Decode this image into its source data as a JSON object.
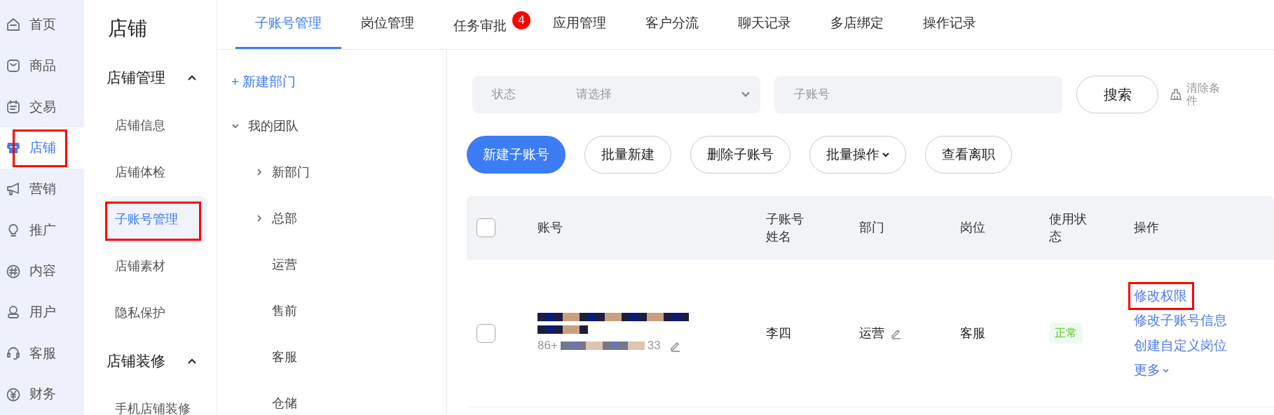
{
  "nav": [
    {
      "label": "首页",
      "selected": false,
      "annotated": false
    },
    {
      "label": "商品",
      "selected": false,
      "annotated": false
    },
    {
      "label": "交易",
      "selected": false,
      "annotated": false
    },
    {
      "label": "店铺",
      "selected": true,
      "annotated": true
    },
    {
      "label": "营销",
      "selected": false,
      "annotated": false
    },
    {
      "label": "推广",
      "selected": false,
      "annotated": false
    },
    {
      "label": "内容",
      "selected": false,
      "annotated": false
    },
    {
      "label": "用户",
      "selected": false,
      "annotated": false
    },
    {
      "label": "客服",
      "selected": false,
      "annotated": false
    },
    {
      "label": "财务",
      "selected": false,
      "annotated": false
    }
  ],
  "sidebar": {
    "title": "店铺",
    "groups": [
      {
        "label": "店铺管理",
        "expanded": true,
        "items": [
          {
            "label": "店铺信息",
            "selected": false,
            "annotated": false
          },
          {
            "label": "店铺体检",
            "selected": false,
            "annotated": false
          },
          {
            "label": "子账号管理",
            "selected": true,
            "annotated": true
          },
          {
            "label": "店铺素材",
            "selected": false,
            "annotated": false
          },
          {
            "label": "隐私保护",
            "selected": false,
            "annotated": false
          }
        ]
      },
      {
        "label": "店铺装修",
        "expanded": true,
        "items": [
          {
            "label": "手机店铺装修",
            "selected": false,
            "annotated": false
          }
        ]
      }
    ]
  },
  "tabs": [
    {
      "label": "子账号管理",
      "selected": true
    },
    {
      "label": "岗位管理",
      "selected": false
    },
    {
      "label": "任务审批",
      "selected": false,
      "badge": "4"
    },
    {
      "label": "应用管理",
      "selected": false
    },
    {
      "label": "客户分流",
      "selected": false
    },
    {
      "label": "聊天记录",
      "selected": false
    },
    {
      "label": "多店绑定",
      "selected": false
    },
    {
      "label": "操作记录",
      "selected": false
    }
  ],
  "tree": {
    "new_button": "+ 新建部门",
    "nodes": [
      {
        "label": "我的团队",
        "expanded": true,
        "children": [
          {
            "label": "新部门",
            "expanded": false
          },
          {
            "label": "总部",
            "expanded": false
          },
          {
            "label": "运营"
          },
          {
            "label": "售前"
          },
          {
            "label": "客服"
          },
          {
            "label": "仓储"
          }
        ]
      }
    ]
  },
  "filters": [
    {
      "kind": "select",
      "label": "状态",
      "placeholder": "请选择"
    },
    {
      "kind": "input",
      "placeholder": "子账号"
    }
  ],
  "search_button": "搜索",
  "clear_button": "清除条件",
  "actions": [
    {
      "label": "新建子账号",
      "primary": true,
      "dropdown": false
    },
    {
      "label": "批量新建",
      "primary": false,
      "dropdown": false
    },
    {
      "label": "删除子账号",
      "primary": false,
      "dropdown": false
    },
    {
      "label": "批量操作",
      "primary": false,
      "dropdown": true
    },
    {
      "label": "查看离职",
      "primary": false,
      "dropdown": false
    }
  ],
  "table": {
    "select_all_checked": false,
    "columns": [
      "账号",
      "子账号姓名",
      "部门",
      "岗位",
      "使用状态",
      "操作"
    ],
    "rows": [
      {
        "checked": false,
        "phone_prefix": "86+",
        "phone_suffix": "33",
        "name": "李四",
        "department": "运营",
        "position": "客服",
        "status": {
          "label": "正常",
          "kind": "normal"
        },
        "actions": [
          {
            "label": "修改权限",
            "annotated": true,
            "dropdown": false
          },
          {
            "label": "修改子账号信息",
            "annotated": false,
            "dropdown": false
          },
          {
            "label": "创建自定义岗位",
            "annotated": false,
            "dropdown": false
          },
          {
            "label": "更多",
            "annotated": false,
            "dropdown": true
          }
        ]
      }
    ]
  }
}
